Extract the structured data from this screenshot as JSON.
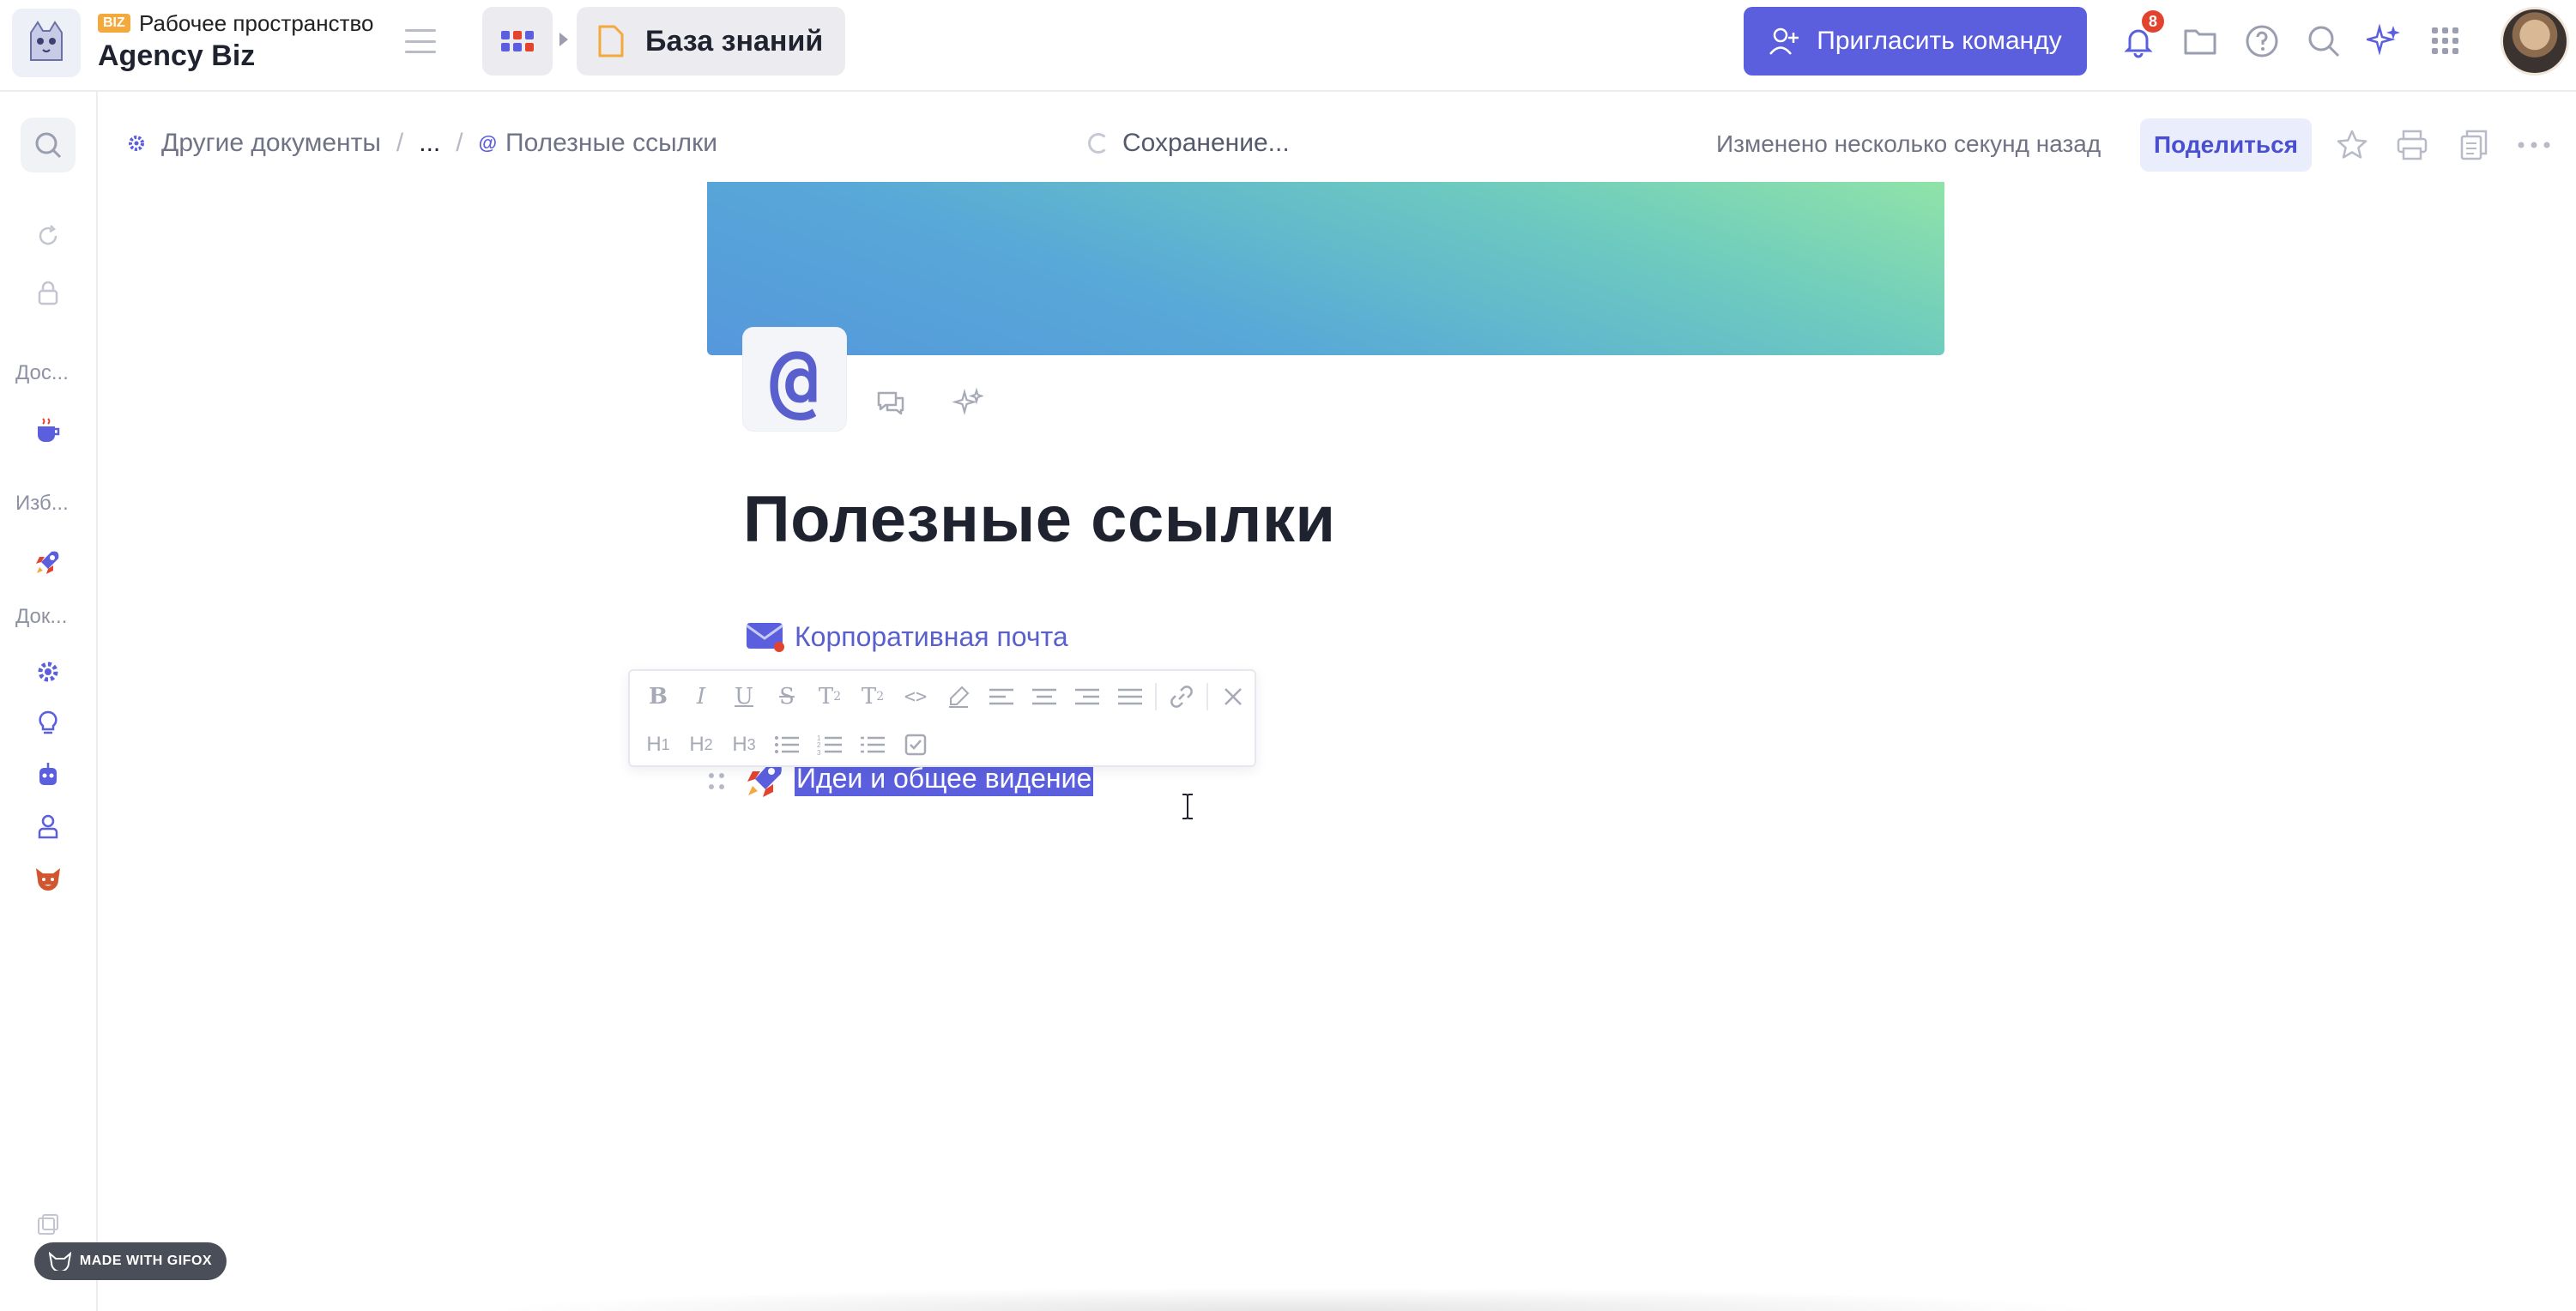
{
  "workspace": {
    "badge": "BIZ",
    "label": "Рабочее пространство",
    "name": "Agency Biz"
  },
  "header": {
    "section_title": "База знаний",
    "invite_label": "Пригласить команду",
    "notifications_count": "8"
  },
  "rail": {
    "labels": [
      "Дос...",
      "Изб...",
      "Док..."
    ]
  },
  "breadcrumbs": {
    "parent": "Другие документы",
    "ellipsis": "...",
    "current": "Полезные ссылки"
  },
  "status": {
    "saving": "Сохранение...",
    "modified": "Изменено несколько секунд назад",
    "share_label": "Поделиться"
  },
  "document": {
    "emoji": "@",
    "title": "Полезные ссылки",
    "links": [
      {
        "icon": "envelope-icon",
        "text": "Корпоративная почта"
      },
      {
        "icon": "rocket-icon",
        "text": "Идеи и общее видение"
      }
    ]
  },
  "toolbar": {
    "row1": [
      "B",
      "I",
      "U",
      "S",
      "T₂",
      "T²",
      "<>",
      "highlight",
      "align-left",
      "align-center",
      "align-right",
      "align-justify",
      "link",
      "close"
    ],
    "row2": [
      "H1",
      "H2",
      "H3",
      "bullet-list",
      "numbered-list",
      "indent-list",
      "checklist"
    ]
  },
  "watermark": "MADE WITH GIFOX",
  "colors": {
    "accent": "#5b5fdd",
    "kb_icon": "#f3a93c",
    "notification": "#e3432e"
  }
}
